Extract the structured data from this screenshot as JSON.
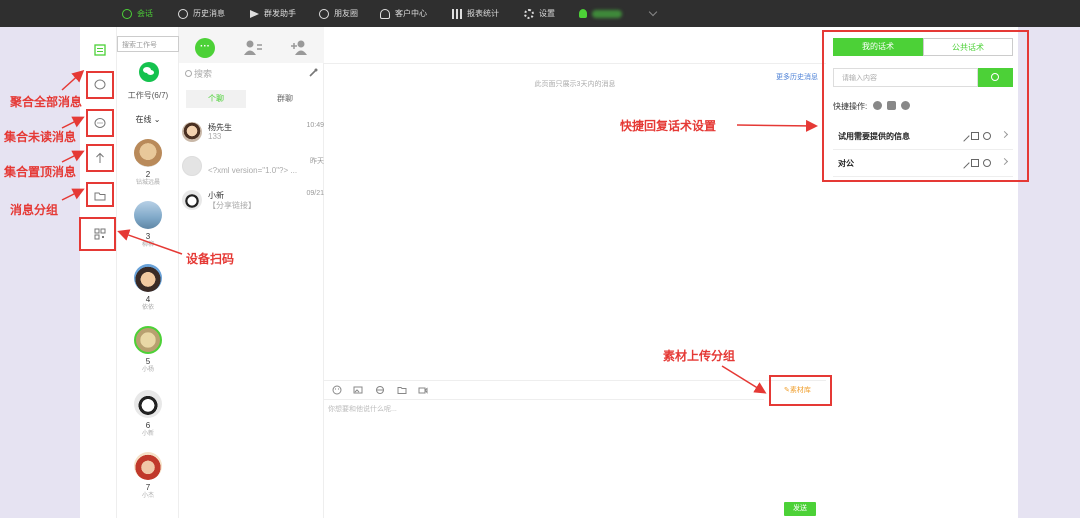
{
  "nav": {
    "items": [
      {
        "label": "会话",
        "icon": "chat-bubble-icon"
      },
      {
        "label": "历史消息",
        "icon": "clock-icon"
      },
      {
        "label": "群发助手",
        "icon": "send-icon"
      },
      {
        "label": "朋友圈",
        "icon": "camera-icon"
      },
      {
        "label": "客户中心",
        "icon": "person-icon"
      },
      {
        "label": "报表统计",
        "icon": "bar-chart-icon"
      },
      {
        "label": "设置",
        "icon": "gear-icon"
      }
    ]
  },
  "workers": {
    "search_placeholder": "搜索工作号",
    "count_label": "工作号(6/7)",
    "status_label": "在线",
    "list": [
      {
        "num": "2",
        "name": "钻城远晨"
      },
      {
        "num": "3",
        "name": "柳柳"
      },
      {
        "num": "4",
        "name": "依依"
      },
      {
        "num": "5",
        "name": "小杨"
      },
      {
        "num": "6",
        "name": "小新"
      },
      {
        "num": "7",
        "name": "小杰"
      }
    ]
  },
  "chatlist": {
    "search_placeholder": "搜索",
    "tab_chat_glyph": "···",
    "seg_private": "个聊",
    "seg_group": "群聊",
    "conversations": [
      {
        "name": "杨先生",
        "msg": "133",
        "time": "10:49"
      },
      {
        "name": "",
        "msg": "<?xml version=\"1.0\"?> ...",
        "time": "昨天"
      },
      {
        "name": "小新",
        "msg": "【分享链接】",
        "time": "09/21"
      }
    ]
  },
  "chat": {
    "notice": "此页面只展示3天内的消息",
    "more_history": "更多历史消息",
    "input_placeholder": "你想要和他说什么呢...",
    "material_label": "素材库",
    "send_label": "发送"
  },
  "quick_reply": {
    "tab_mine": "我的话术",
    "tab_public": "公共话术",
    "search_placeholder": "请输入内容",
    "quick_ops_label": "快捷操作:",
    "rows": [
      {
        "label": "试用需要提供的信息"
      },
      {
        "label": "对公"
      }
    ]
  },
  "annotations": {
    "merge_all": "聚合全部消息",
    "merge_unread": "集合未读消息",
    "merge_pinned": "集合置顶消息",
    "msg_group": "消息分组",
    "device_scan": "设备扫码",
    "quick_reply_settings": "快捷回复话术设置",
    "material_upload": "素材上传分组"
  },
  "colors": {
    "accent_green": "#4cd137",
    "annotation_red": "#e53935",
    "nav_bg": "#2f2f2f"
  }
}
